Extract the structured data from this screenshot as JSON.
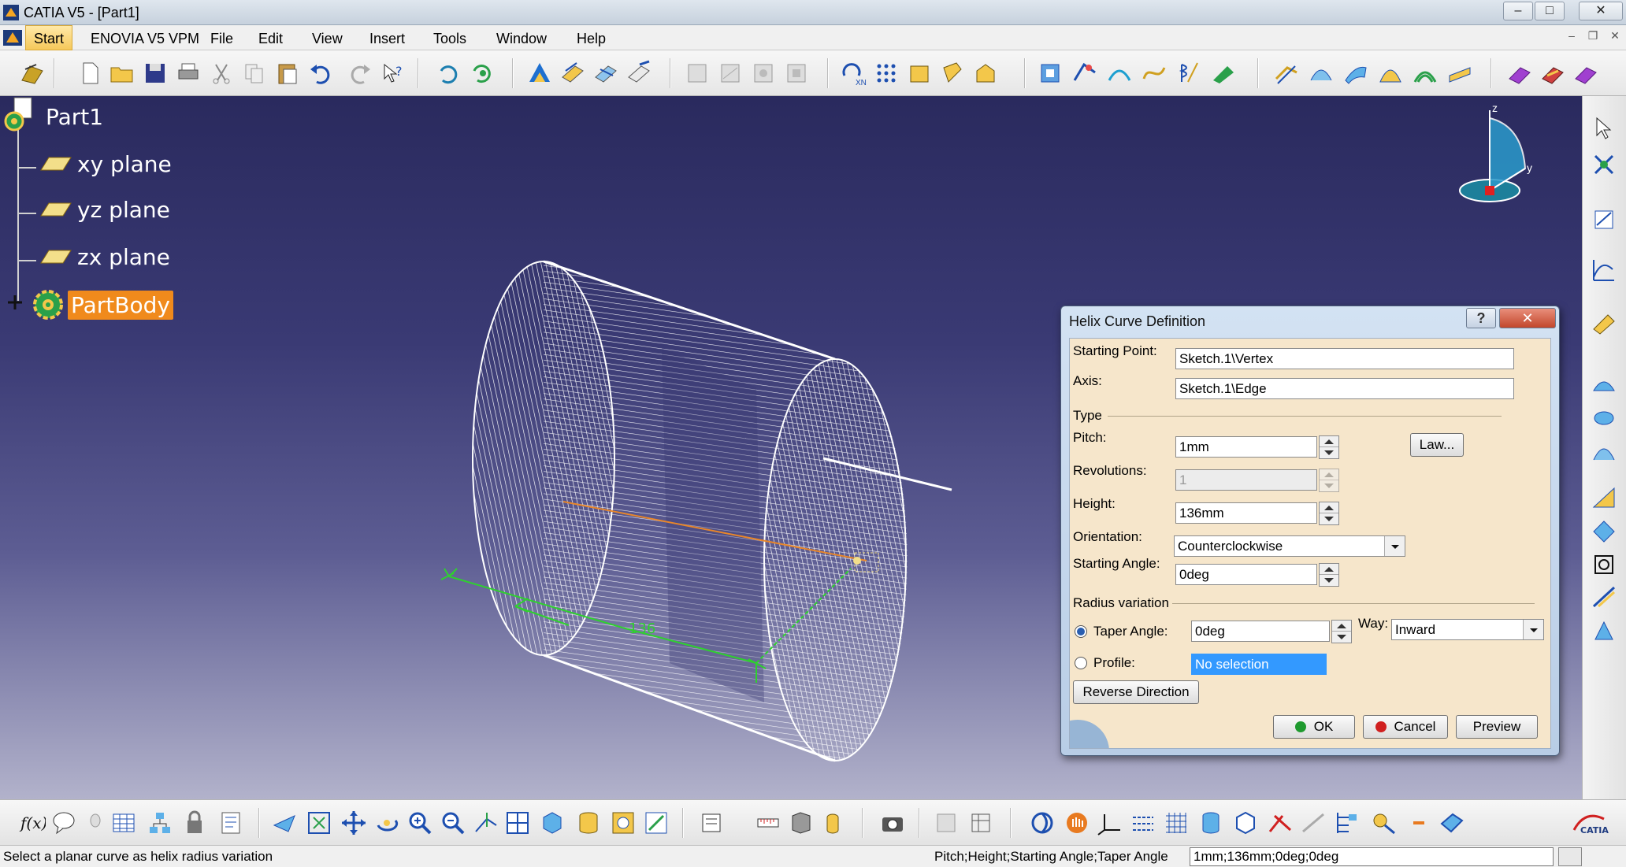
{
  "window": {
    "title": "CATIA V5 - [Part1]",
    "controls": [
      "–",
      "□",
      "✕"
    ]
  },
  "menubar": {
    "items": [
      "Start",
      "ENOVIA V5 VPM",
      "File",
      "Edit",
      "View",
      "Insert",
      "Tools",
      "Window",
      "Help"
    ]
  },
  "tree": {
    "root": "Part1",
    "items": [
      "xy plane",
      "yz plane",
      "zx plane",
      "PartBody"
    ],
    "selected": "PartBody"
  },
  "viewport": {
    "helix_annotation": "136",
    "compass_axis_z": "z",
    "compass_axis_y": "y"
  },
  "dialog": {
    "title": "Helix Curve Definition",
    "help_btn": "?",
    "close_btn": "✕",
    "starting_point_label": "Starting Point:",
    "starting_point_value": "Sketch.1\\Vertex",
    "axis_label": "Axis:",
    "axis_value": "Sketch.1\\Edge",
    "type_group": "Type",
    "pitch_label": "Pitch:",
    "pitch_value": "1mm",
    "law_button": "Law...",
    "revolutions_label": "Revolutions:",
    "revolutions_value": "1",
    "height_label": "Height:",
    "height_value": "136mm",
    "orientation_label": "Orientation:",
    "orientation_value": "Counterclockwise",
    "starting_angle_label": "Starting Angle:",
    "starting_angle_value": "0deg",
    "radius_group": "Radius variation",
    "taper_label": "Taper Angle:",
    "taper_value": "0deg",
    "way_label": "Way:",
    "way_value": "Inward",
    "profile_label": "Profile:",
    "profile_value": "No selection",
    "reverse_button": "Reverse Direction",
    "ok_button": "OK",
    "cancel_button": "Cancel",
    "preview_button": "Preview"
  },
  "status": {
    "message": "Select a planar curve as helix radius variation",
    "params_label": "Pitch;Height;Starting Angle;Taper Angle",
    "params_value": "1mm;136mm;0deg;0deg"
  },
  "colors": {
    "selection": "#f08a1c",
    "helix_green": "#2fd02f",
    "axis_orange": "#e8862a",
    "ok_green": "#1f9a2e",
    "cancel_red": "#d02020"
  }
}
